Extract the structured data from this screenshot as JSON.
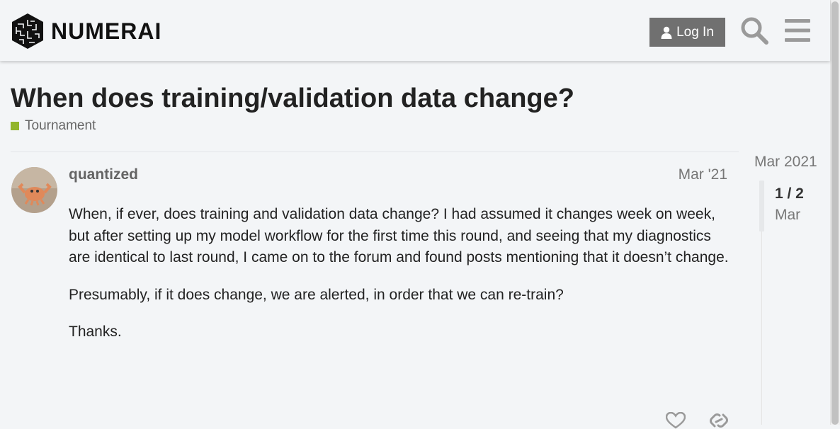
{
  "header": {
    "logo_text": "NUMERAI",
    "login_label": "Log In",
    "icons": {
      "login": "user-icon",
      "search": "search-icon",
      "menu": "hamburger-menu-icon"
    }
  },
  "topic": {
    "title": "When does training/validation data change?",
    "category": "Tournament",
    "category_color": "#92b52b"
  },
  "post": {
    "username": "quantized",
    "date": "Mar '21",
    "paragraphs": [
      "When, if ever, does training and validation data change? I had assumed it changes week on week, but after setting up my model workflow for the first time this round, and seeing that my diagnostics are identical to last round, I came on to the forum and found posts mentioning that it doesn’t change.",
      "Presumably, if it does change, we are alerted, in order that we can re-train?",
      "Thanks."
    ],
    "actions": {
      "like": "heart-icon",
      "share": "link-icon"
    }
  },
  "timeline": {
    "start_date": "Mar 2021",
    "position": "1 / 2",
    "current_date": "Mar"
  }
}
